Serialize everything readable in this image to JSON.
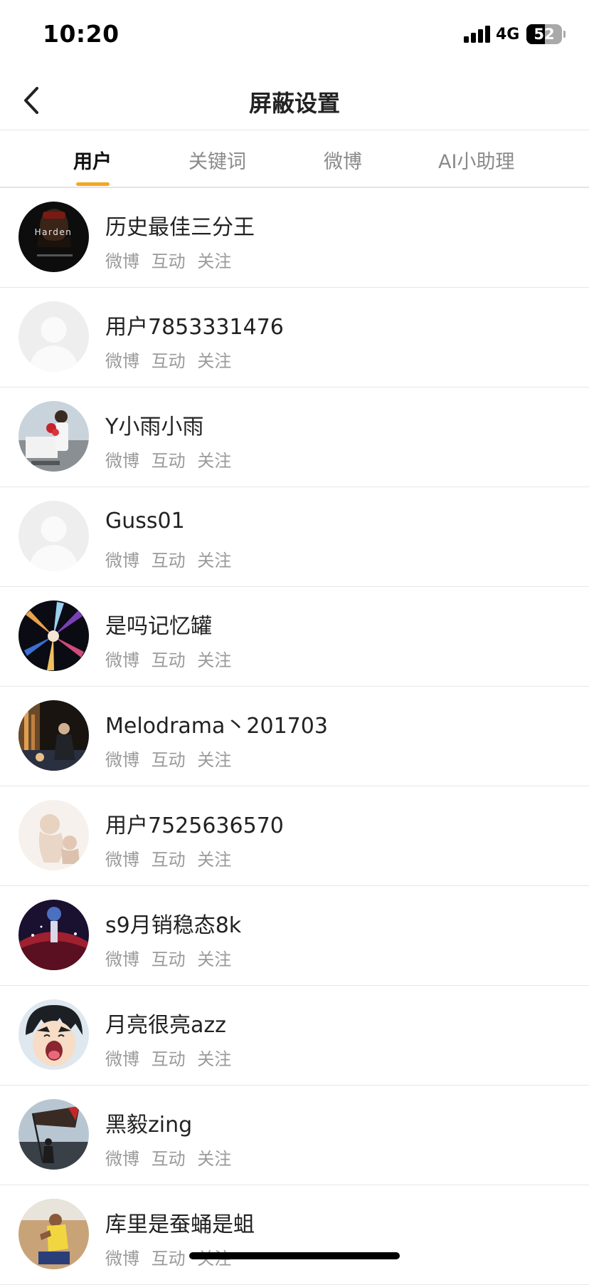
{
  "status_bar": {
    "time": "10:20",
    "network": "4G",
    "battery": "52",
    "battery_level": 0.52
  },
  "header": {
    "title": "屏蔽设置"
  },
  "tabs": [
    {
      "label": "用户",
      "active": true
    },
    {
      "label": "关键词",
      "active": false
    },
    {
      "label": "微博",
      "active": false
    },
    {
      "label": "AI小助理",
      "active": false
    }
  ],
  "actions": {
    "weibo": "微博",
    "interact": "互动",
    "follow": "关注"
  },
  "users": [
    {
      "name": "历史最佳三分王",
      "avatar_text": "Harden"
    },
    {
      "name": "用户7853331476"
    },
    {
      "name": "Y小雨小雨"
    },
    {
      "name": "Guss01"
    },
    {
      "name": "是吗记忆罐"
    },
    {
      "name": "Melodrama丶201703"
    },
    {
      "name": "用户7525636570"
    },
    {
      "name": "s9月销稳态8k"
    },
    {
      "name": "月亮很亮azz"
    },
    {
      "name": "黑毅zing"
    },
    {
      "name": "库里是蚕蛹是蛆"
    }
  ],
  "colors": {
    "accent": "#f5a623",
    "text_primary": "#222222",
    "text_secondary": "#9a9a9a",
    "divider": "#e7e7e7"
  }
}
